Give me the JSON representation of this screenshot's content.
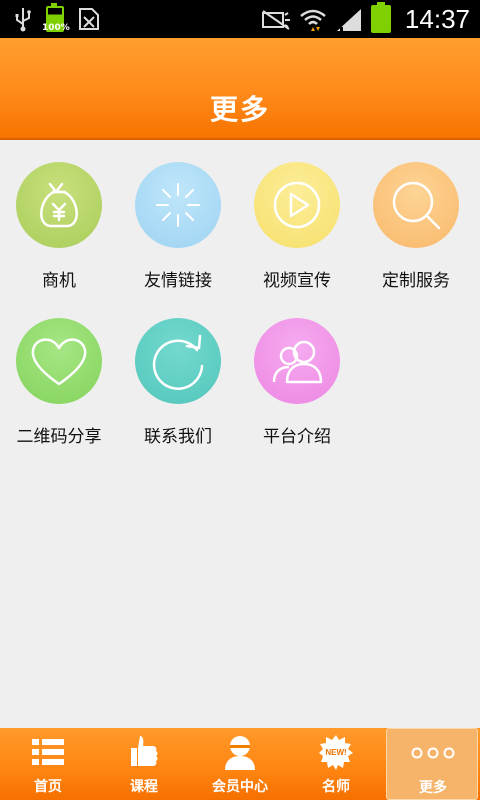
{
  "status_bar": {
    "time": "14:37",
    "battery_small_label": "100%",
    "icons": [
      "usb-icon",
      "battery-icon",
      "sim-icon",
      "mute-icon",
      "wifi-icon",
      "signal-icon",
      "battery-icon"
    ]
  },
  "header": {
    "title": "更多"
  },
  "grid": {
    "items": [
      {
        "label": "商机",
        "icon": "money-bag-icon",
        "color": "#b7d56b"
      },
      {
        "label": "友情链接",
        "icon": "loading-spinner-icon",
        "color": "#a9dcf6"
      },
      {
        "label": "视频宣传",
        "icon": "play-icon",
        "color": "#f8e57e"
      },
      {
        "label": "定制服务",
        "icon": "search-icon",
        "color": "#fbc47c"
      },
      {
        "label": "二维码分享",
        "icon": "heart-icon",
        "color": "#8fda6c"
      },
      {
        "label": "联系我们",
        "icon": "refresh-icon",
        "color": "#5ccfc5"
      },
      {
        "label": "平台介绍",
        "icon": "users-icon",
        "color": "#f095e8"
      }
    ]
  },
  "tabbar": {
    "items": [
      {
        "label": "首页",
        "icon": "list-icon"
      },
      {
        "label": "课程",
        "icon": "thumbs-up-icon"
      },
      {
        "label": "会员中心",
        "icon": "person-icon"
      },
      {
        "label": "名师",
        "icon": "new-badge-icon",
        "badge_text": "NEW!"
      },
      {
        "label": "更多",
        "icon": "more-dots-icon",
        "active": true
      }
    ]
  },
  "colors": {
    "accent": "#ff8a1a",
    "background": "#efefef"
  }
}
